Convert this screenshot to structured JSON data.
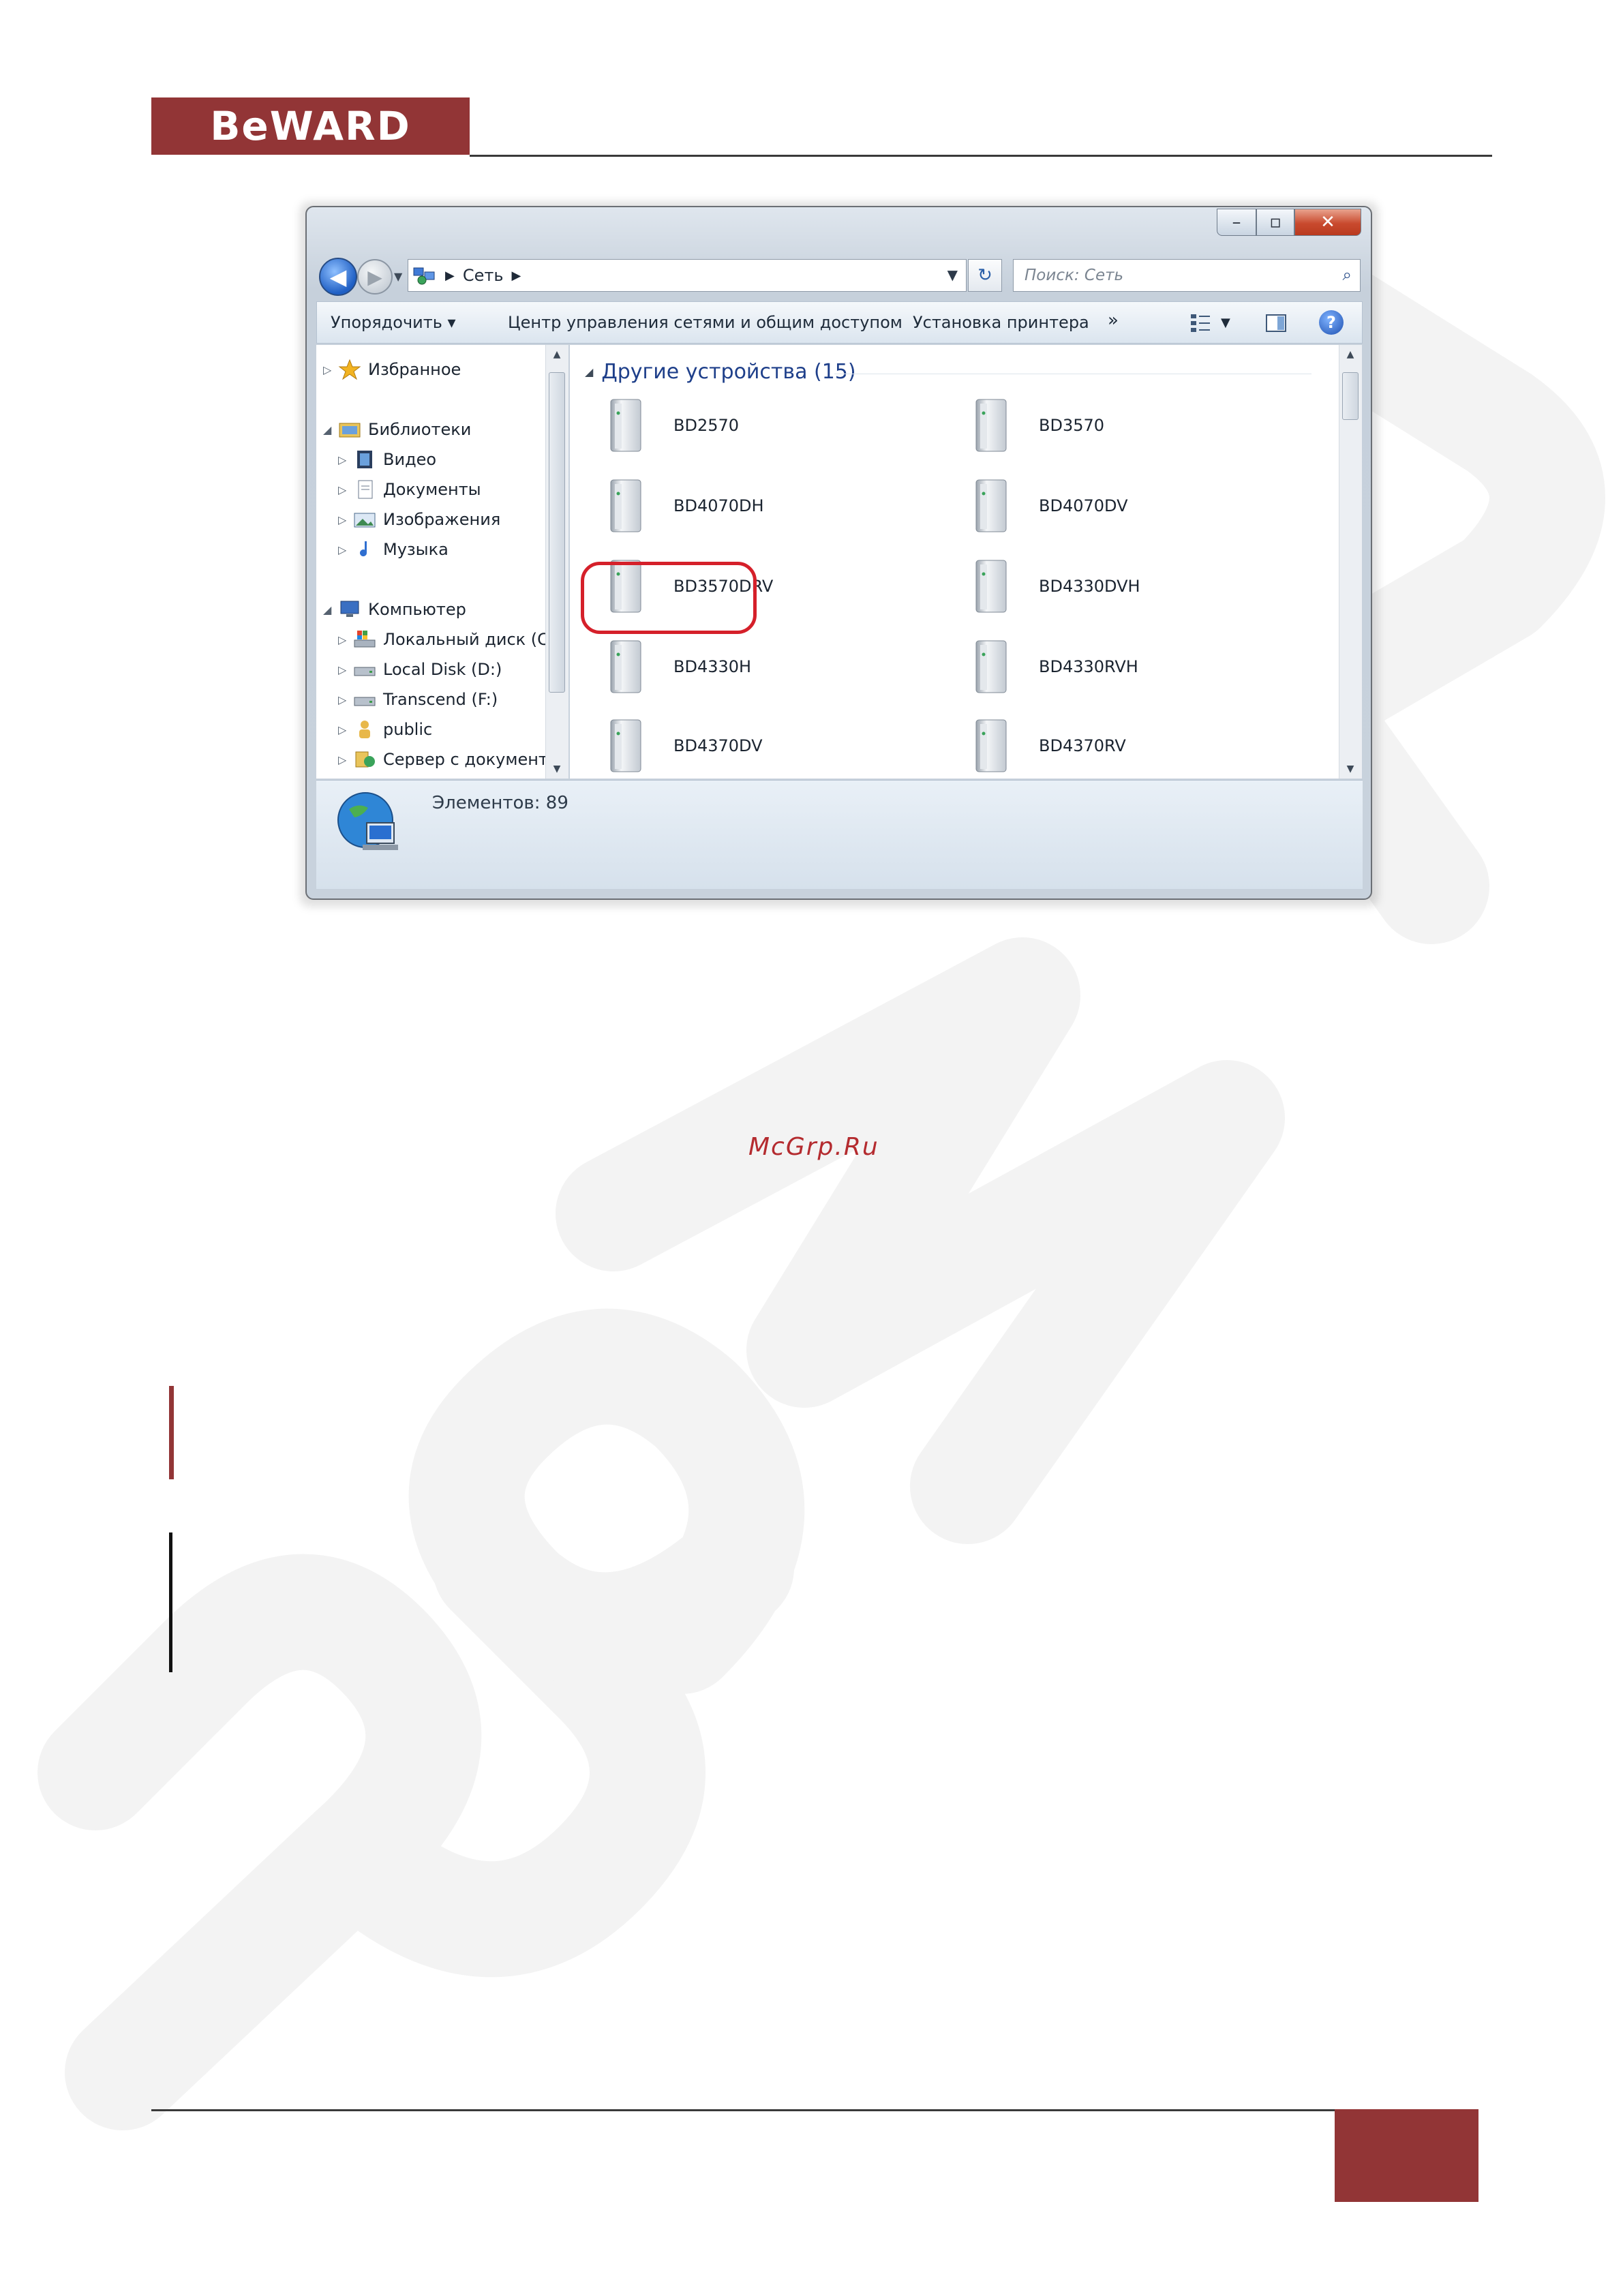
{
  "header": {
    "logo_text": "BeWARD"
  },
  "window": {
    "address": {
      "crumb": "Сеть"
    },
    "search_placeholder": "Поиск: Сеть",
    "commands": {
      "organize": "Упорядочить ▾",
      "network_center": "Центр управления сетями и общим доступом",
      "add_printer": "Установка принтера",
      "more": "»"
    },
    "nav": {
      "favorites": "Избранное",
      "libraries": "Библиотеки",
      "video": "Видео",
      "documents": "Документы",
      "images": "Изображения",
      "music": "Музыка",
      "computer": "Компьютер",
      "local_c": "Локальный диск (C",
      "local_d": "Local Disk (D:)",
      "transcend": "Transcend (F:)",
      "public": "public",
      "server": "Сервер с документ"
    },
    "group_title": "Другие устройства (15)",
    "devices": [
      "BD2570",
      "BD3570",
      "BD4070DH",
      "BD4070DV",
      "BD3570DRV",
      "BD4330DVH",
      "BD4330H",
      "BD4330RVH",
      "BD4370DV",
      "BD4370RV"
    ],
    "highlighted_device": "BD3570DRV",
    "status": "Элементов: 89"
  },
  "watermark_site": "McGrp.Ru",
  "colors": {
    "brand": "#923536",
    "highlight": "#d5202a",
    "link": "#b42b2f"
  }
}
